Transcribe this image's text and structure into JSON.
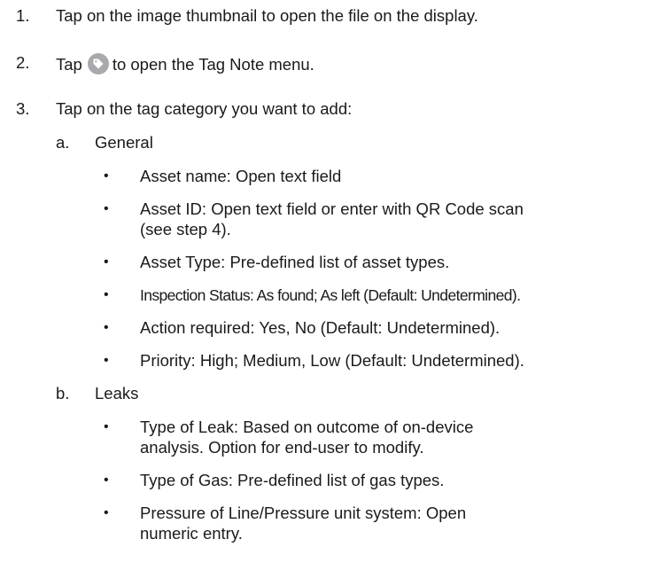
{
  "steps": [
    {
      "number": "1.",
      "text": "Tap on the image thumbnail to open the file on the display."
    },
    {
      "number": "2.",
      "text_before": "Tap",
      "icon": "tag-icon",
      "text_after": "to open the Tag Note menu."
    },
    {
      "number": "3.",
      "text": "Tap on the tag category you want to add:"
    }
  ],
  "categories": [
    {
      "letter": "a.",
      "name": "General",
      "items": [
        {
          "lines": [
            "Asset name: Open text field"
          ]
        },
        {
          "lines": [
            "Asset ID: Open text field or enter with QR Code scan",
            "(see step 4)."
          ]
        },
        {
          "lines": [
            "Asset Type: Pre-defined list of asset types."
          ]
        },
        {
          "lines": [
            "Inspection Status: As found; As left (Default: Undetermined)."
          ]
        },
        {
          "lines": [
            "Action required: Yes, No (Default: Undetermined)."
          ]
        },
        {
          "lines": [
            "Priority: High; Medium, Low (Default: Undetermined)."
          ]
        }
      ]
    },
    {
      "letter": "b.",
      "name": "Leaks",
      "items": [
        {
          "lines": [
            "Type of Leak: Based on outcome of on-device",
            "analysis. Option for end-user to modify."
          ]
        },
        {
          "lines": [
            "Type of Gas: Pre-defined list of gas types."
          ]
        },
        {
          "lines": [
            "Pressure of Line/Pressure unit system: Open",
            "numeric entry."
          ]
        }
      ]
    }
  ],
  "bullet_glyph": "•"
}
